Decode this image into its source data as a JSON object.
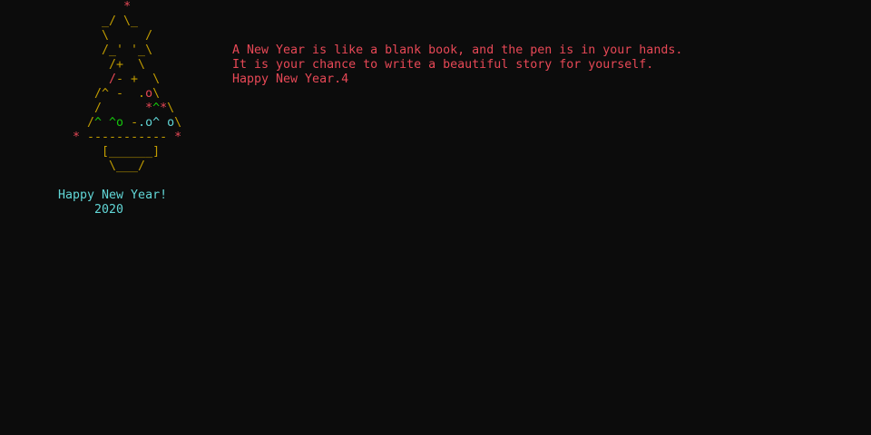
{
  "colors": {
    "background": "#0c0c0c",
    "red": "#e74856",
    "yellow": "#c19c00",
    "green": "#16c60c",
    "cyan": "#61d6d6",
    "white": "#cccccc"
  },
  "tree": {
    "lines": [
      [
        {
          "t": "         ",
          "c": "white"
        },
        {
          "t": "*",
          "c": "red"
        }
      ],
      [
        {
          "t": "      _/ \\_",
          "c": "yellow"
        }
      ],
      [
        {
          "t": "      \\     /",
          "c": "yellow"
        }
      ],
      [
        {
          "t": "      /_' '_\\",
          "c": "yellow"
        }
      ],
      [
        {
          "t": "       /+  \\",
          "c": "yellow"
        }
      ],
      [
        {
          "t": "       /",
          "c": "red"
        },
        {
          "t": "- +  \\",
          "c": "yellow"
        }
      ],
      [
        {
          "t": "     /^ -  .",
          "c": "yellow"
        },
        {
          "t": "o",
          "c": "red"
        },
        {
          "t": "\\",
          "c": "yellow"
        }
      ],
      [
        {
          "t": "     /      ",
          "c": "yellow"
        },
        {
          "t": "*",
          "c": "red"
        },
        {
          "t": "^",
          "c": "green"
        },
        {
          "t": "*",
          "c": "red"
        },
        {
          "t": "\\",
          "c": "yellow"
        }
      ],
      [
        {
          "t": "    /",
          "c": "yellow"
        },
        {
          "t": "^ ^o",
          "c": "green"
        },
        {
          "t": " -",
          "c": "yellow"
        },
        {
          "t": ".o^ o",
          "c": "cyan"
        },
        {
          "t": "\\",
          "c": "yellow"
        }
      ],
      [
        {
          "t": "  * ",
          "c": "red"
        },
        {
          "t": "-----------",
          "c": "yellow"
        },
        {
          "t": " *",
          "c": "red"
        }
      ],
      [
        {
          "t": "      [______]",
          "c": "yellow"
        }
      ],
      [
        {
          "t": "       \\___/",
          "c": "yellow"
        }
      ]
    ],
    "greeting": "Happy New Year!",
    "year": "2020"
  },
  "message": {
    "line1": "A New Year is like a blank book, and the pen is in your hands.",
    "line2": "It is your chance to write a beautiful story for yourself.",
    "line3": "Happy New Year.4"
  }
}
